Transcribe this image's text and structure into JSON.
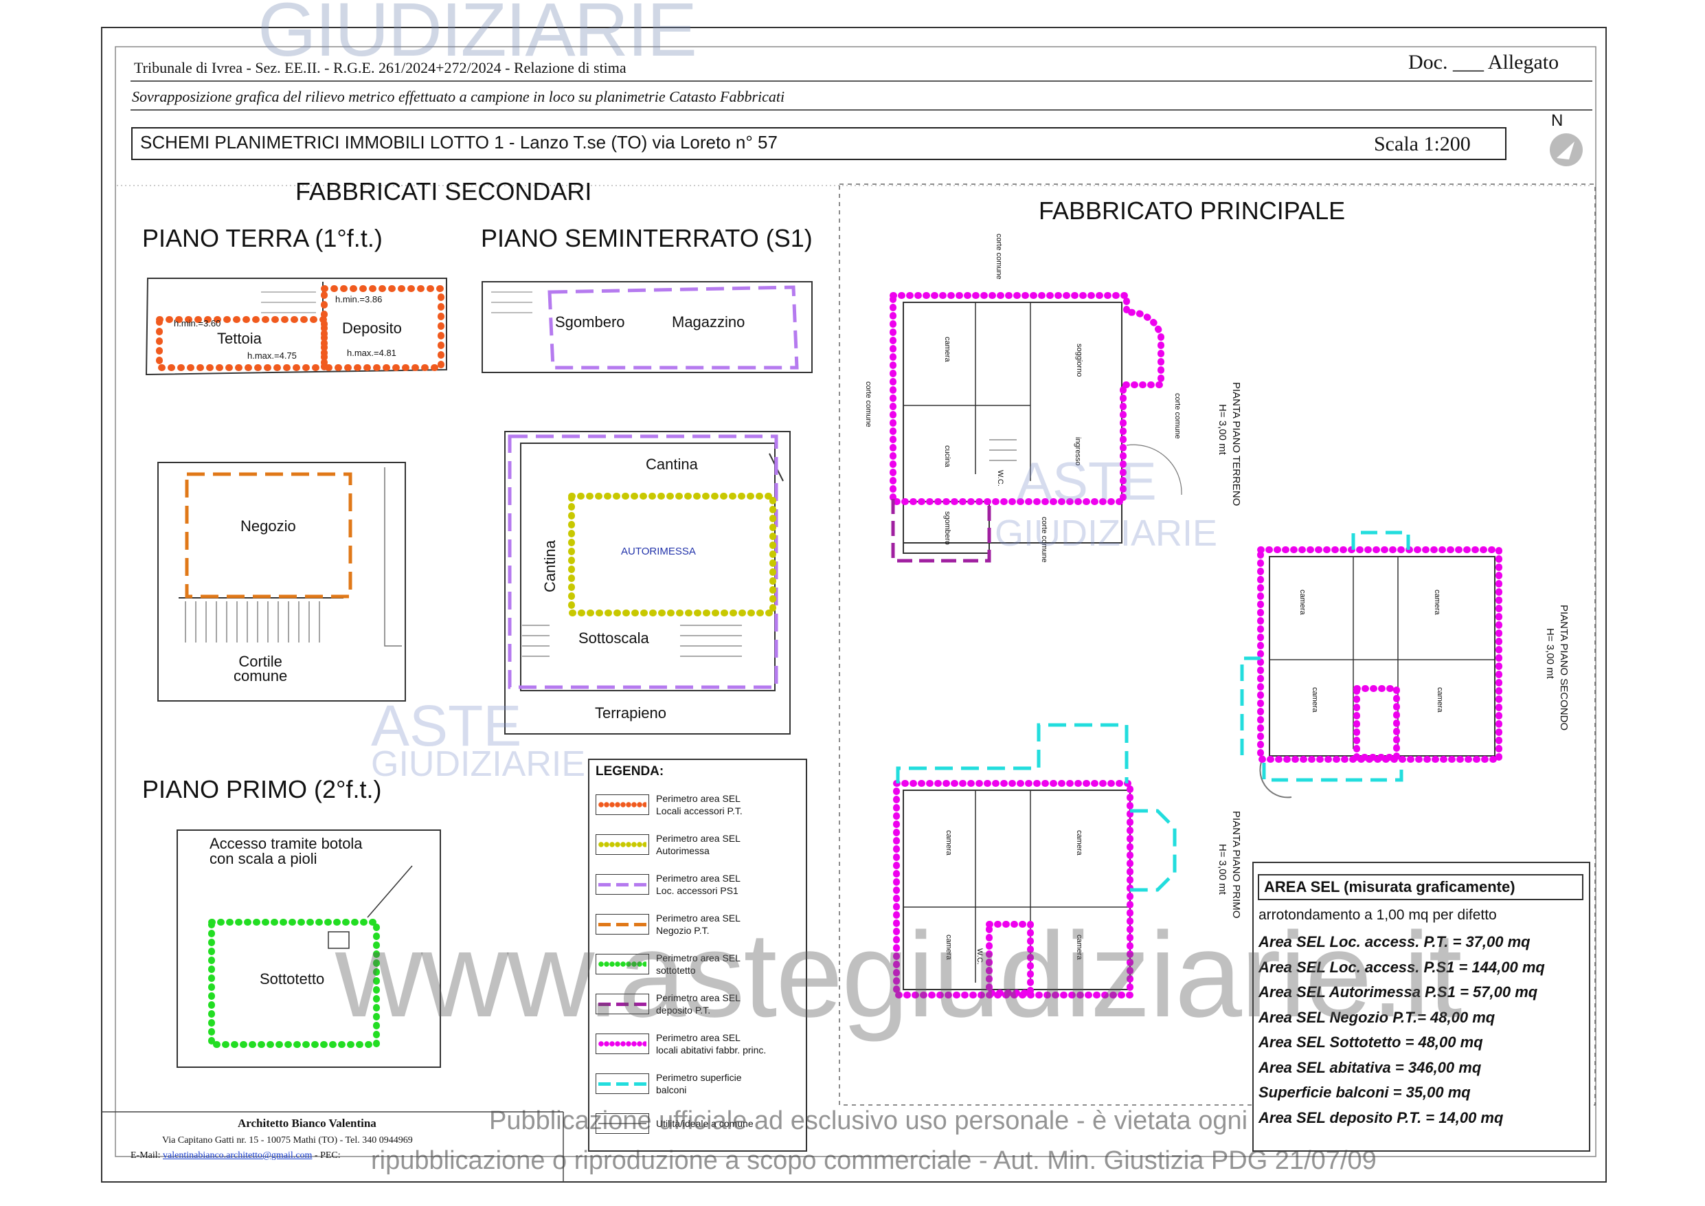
{
  "header": {
    "line1": "Tribunale di Ivrea - Sez. EE.II. - R.G.E. 261/2024+272/2024 - Relazione di stima",
    "doc": "Doc. ___ Allegato",
    "subtitle": "Sovrapposizione grafica del rilievo metrico effettuato a campione in loco su planimetrie Catasto Fabbricati",
    "schemes": "SCHEMI PLANIMETRICI IMMOBILI LOTTO 1 - Lanzo T.se (TO) via Loreto  n° 57",
    "scale": "Scala 1:200",
    "north": "N"
  },
  "secondary": {
    "title": "FABBRICATI SECONDARI",
    "ground_title": "PIANO TERRA (1°f.t.)",
    "basement_title": "PIANO SEMINTERRATO (S1)",
    "first_title": "PIANO PRIMO (2°f.t.)",
    "rooms": {
      "tettoia": "Tettoia",
      "deposito": "Deposito",
      "hmin1": "h.min.=3.60",
      "hmin2": "h.min.=3.86",
      "hmax1": "h.max.=4.75",
      "hmax2": "h.max.=4.81",
      "sgombero": "Sgombero",
      "magazzino": "Magazzino",
      "negozio": "Negozio",
      "cortile": "Cortile\ncomune",
      "cantina_top": "Cantina",
      "cantina_side": "Cantina",
      "autorimessa": "AUTORIMESSA",
      "sottoscala": "Sottoscala",
      "terrapieno": "Terrapieno",
      "accesso": "Accesso tramite botola\ncon scala a pioli",
      "sottotetto": "Sottotetto"
    }
  },
  "main": {
    "title": "FABBRICATO PRINCIPALE",
    "ground_label": "PIANTA PIANO TERRENO",
    "ground_h": "H= 3,00 mt",
    "first_label": "PIANTA PIANO PRIMO",
    "first_h": "H= 3,00 mt",
    "second_label": "PIANTA PIANO SECONDO",
    "second_h": "H= 3,00 mt",
    "corte": "corte comune",
    "camera": "camera",
    "soggiorno": "soggiorno",
    "cucina": "cucina",
    "ingresso": "ingresso",
    "wc": "W.C.",
    "sgombero": "sgombero"
  },
  "legend": {
    "title": "LEGENDA:",
    "items": [
      {
        "text": "Perimetro area SEL\nLocali accessori P.T.",
        "color": "#f05a1e",
        "style": "dots"
      },
      {
        "text": "Perimetro area SEL\nAutorimessa",
        "color": "#c8c800",
        "style": "dots"
      },
      {
        "text": "Perimetro area SEL\nLoc. accessori PS1",
        "color": "#b57aef",
        "style": "dash"
      },
      {
        "text": "Perimetro area SEL\nNegozio P.T.",
        "color": "#e07818",
        "style": "dash"
      },
      {
        "text": "Perimetro area SEL\nsottotetto",
        "color": "#22dd22",
        "style": "dots"
      },
      {
        "text": "Perimetro area SEL\ndeposito P.T.",
        "color": "#a020a0",
        "style": "dash"
      },
      {
        "text": "Perimetro area SEL\nlocali abitativi fabbr. princ.",
        "color": "#ee00ee",
        "style": "dots"
      },
      {
        "text": "Perimetro superficie\nbalconi",
        "color": "#22dddd",
        "style": "dash"
      },
      {
        "text": "Utilità/ideale a comune",
        "color": "#888888",
        "style": "plain"
      }
    ]
  },
  "area": {
    "title": "AREA SEL  (misurata graficamente)",
    "note": "arrotondamento a 1,00 mq per difetto",
    "lines": [
      "Area SEL Loc. access. P.T. = 37,00 mq",
      "Area SEL Loc. access. P.S1 = 144,00 mq",
      "Area SEL Autorimessa P.S1 = 57,00 mq",
      "Area SEL Negozio P.T.= 48,00 mq",
      "Area SEL Sottotetto = 48,00 mq",
      "Area SEL abitativa = 346,00 mq",
      "Superficie balconi = 35,00 mq",
      "Area SEL deposito P.T. = 14,00 mq"
    ]
  },
  "footer": {
    "architect": "Architetto Bianco Valentina",
    "address": "Via Capitano Gatti nr. 15 - 10075 Mathi (TO) -  Tel. 340 0944969",
    "email_label": "E-Mail: ",
    "email": "valentinabianco.architetto@gmail.com",
    "pec": " - PEC: "
  },
  "watermark": {
    "top": "GIUDIZIARIE",
    "aste": "ASTE",
    "giudiziarie": "GIUDIZIARIE",
    "url": "www.astegiudiziarie.it",
    "notice1": "Pubblicazione ufficiale ad esclusivo uso personale - è vietata ogni",
    "notice2": "ripubblicazione o riproduzione a scopo commerciale - Aut. Min. Giustizia PDG 21/07/09"
  }
}
